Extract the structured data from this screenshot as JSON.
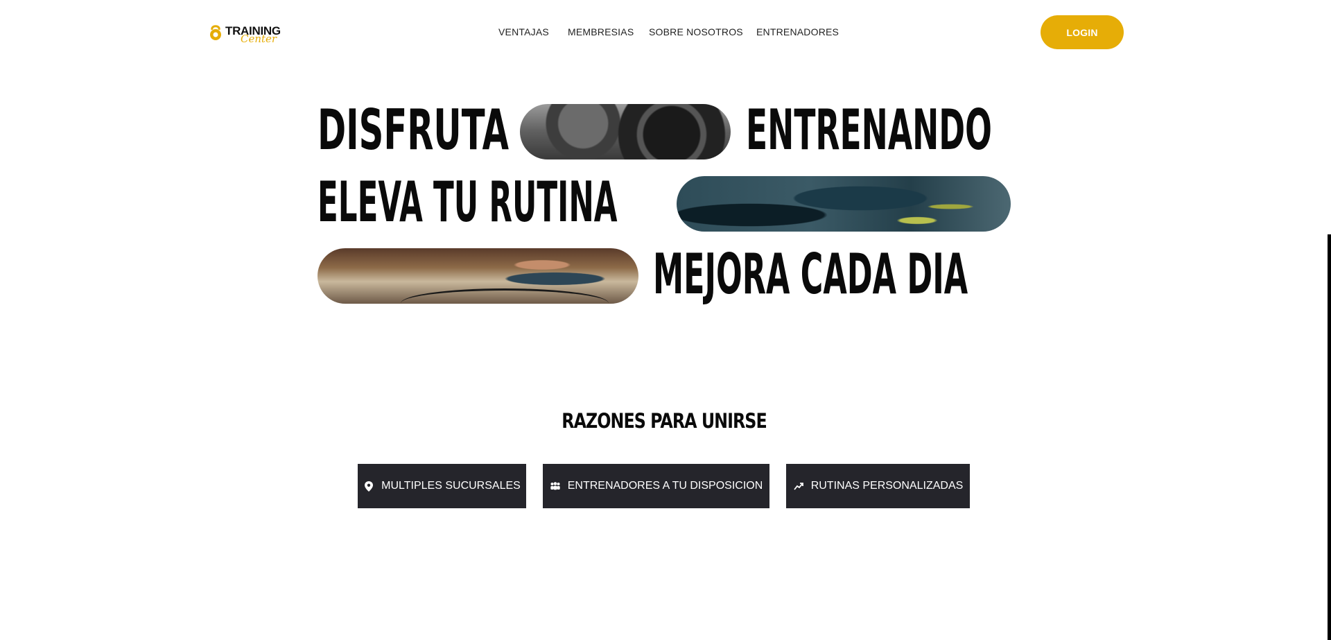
{
  "header": {
    "logo": {
      "main": "TRAINING",
      "sub": "Center",
      "icon": "kettlebell-icon"
    },
    "nav": [
      "VENTAJAS",
      "MEMBRESIAS",
      "SOBRE NOSOTROS",
      "ENTRENADORES"
    ],
    "login_label": "LOGIN"
  },
  "hero": {
    "line1": {
      "left": "DISFRUTA",
      "right": "ENTRENANDO"
    },
    "line2": {
      "left": "ELEVA TU RUTINA"
    },
    "line3": {
      "right": "MEJORA CADA DIA"
    }
  },
  "reasons": {
    "title": "RAZONES PARA UNIRSE",
    "items": [
      {
        "label": "MULTIPLES SUCURSALES",
        "icon": "map-pin-icon"
      },
      {
        "label": "ENTRENADORES A TU DISPOSICION",
        "icon": "users-icon"
      },
      {
        "label": "RUTINAS PERSONALIZADAS",
        "icon": "trend-up-icon"
      }
    ]
  },
  "colors": {
    "accent": "#e6ad07",
    "dark_button": "#25252b",
    "text": "#0a0a0a"
  }
}
